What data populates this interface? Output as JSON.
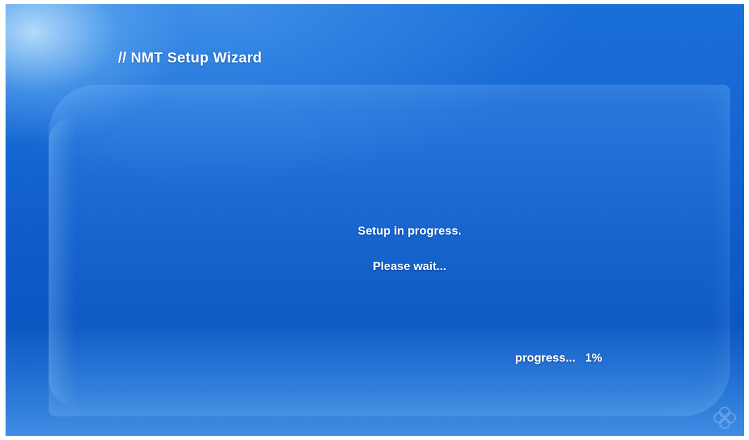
{
  "wizard": {
    "title": "// NMT Setup Wizard"
  },
  "status": {
    "line1": "Setup in progress.",
    "line2": "Please wait...",
    "progress_label": "progress...",
    "progress_value": "1%",
    "progress_percent": 1
  },
  "colors": {
    "background_top": "#1b6fd8",
    "background_bottom": "#0c57c2",
    "text": "#ffffff"
  },
  "icons": {
    "corner": "flower-watermark-icon"
  }
}
